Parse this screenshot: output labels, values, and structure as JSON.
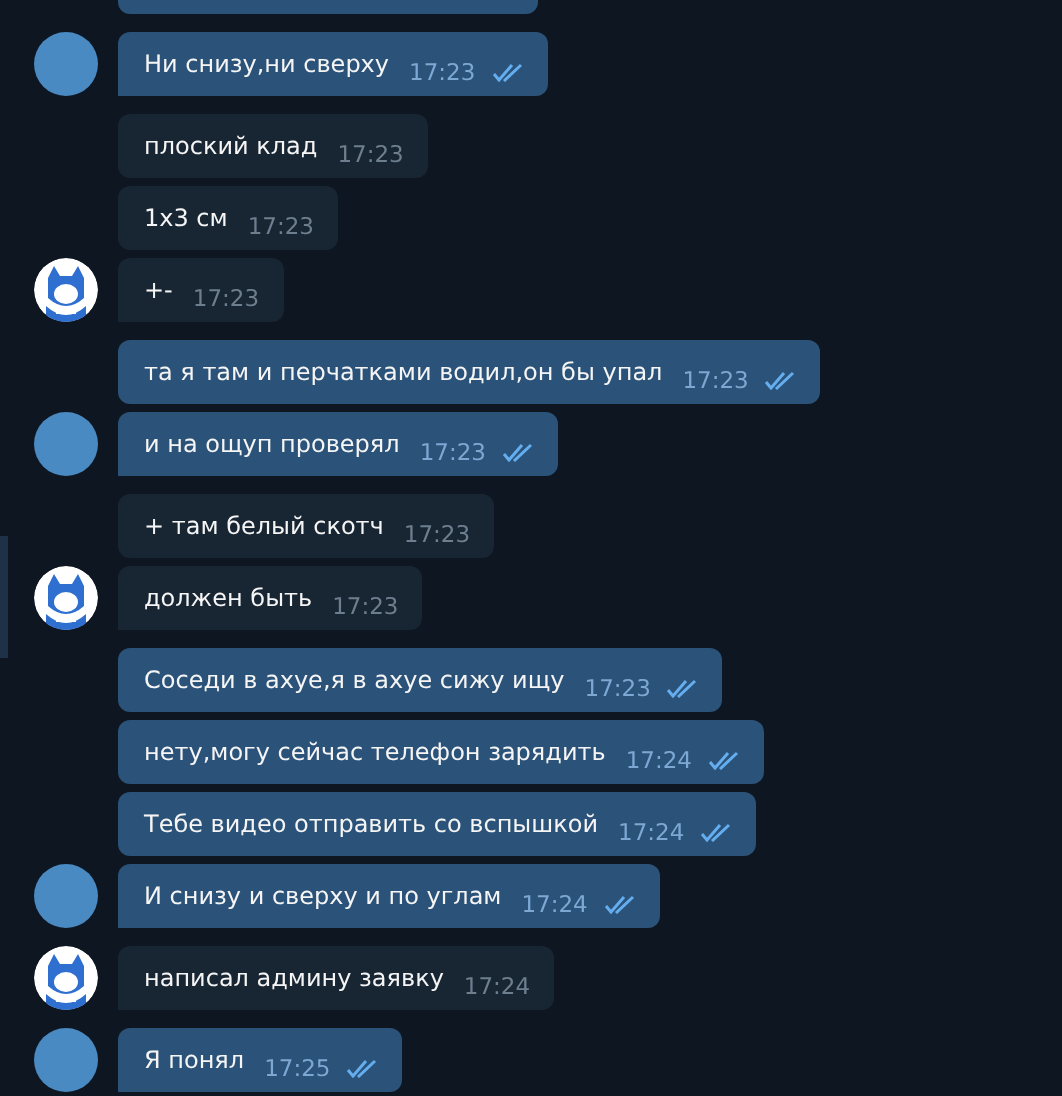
{
  "partial_message_above": true,
  "groups": [
    {
      "kind": "outgoing",
      "messages": [
        {
          "text": "Ни снизу,ни сверху",
          "time": "17:23",
          "read": true
        }
      ]
    },
    {
      "kind": "incoming",
      "messages": [
        {
          "text": "плоский клад",
          "time": "17:23"
        },
        {
          "text": "1х3 см",
          "time": "17:23"
        },
        {
          "text": "+-",
          "time": "17:23"
        }
      ]
    },
    {
      "kind": "outgoing",
      "messages": [
        {
          "text": "та я там и перчатками водил,он бы упал",
          "time": "17:23",
          "read": true
        },
        {
          "text": "и на ощуп проверял",
          "time": "17:23",
          "read": true
        }
      ]
    },
    {
      "kind": "incoming",
      "messages": [
        {
          "text": "+ там белый скотч",
          "time": "17:23"
        },
        {
          "text": "должен быть",
          "time": "17:23"
        }
      ]
    },
    {
      "kind": "outgoing",
      "messages": [
        {
          "text": "Соседи в ахуе,я в ахуе сижу ищу",
          "time": "17:23",
          "read": true
        },
        {
          "text": "нету,могу сейчас телефон зарядить",
          "time": "17:24",
          "read": true
        },
        {
          "text": "Тебе видео отправить со вспышкой",
          "time": "17:24",
          "read": true
        },
        {
          "text": "И снизу и сверху и по углам",
          "time": "17:24",
          "read": true
        }
      ]
    },
    {
      "kind": "incoming",
      "messages": [
        {
          "text": "написал админу заявку",
          "time": "17:24"
        }
      ]
    },
    {
      "kind": "outgoing",
      "messages": [
        {
          "text": "Я понял",
          "time": "17:25",
          "read": true
        }
      ]
    }
  ]
}
